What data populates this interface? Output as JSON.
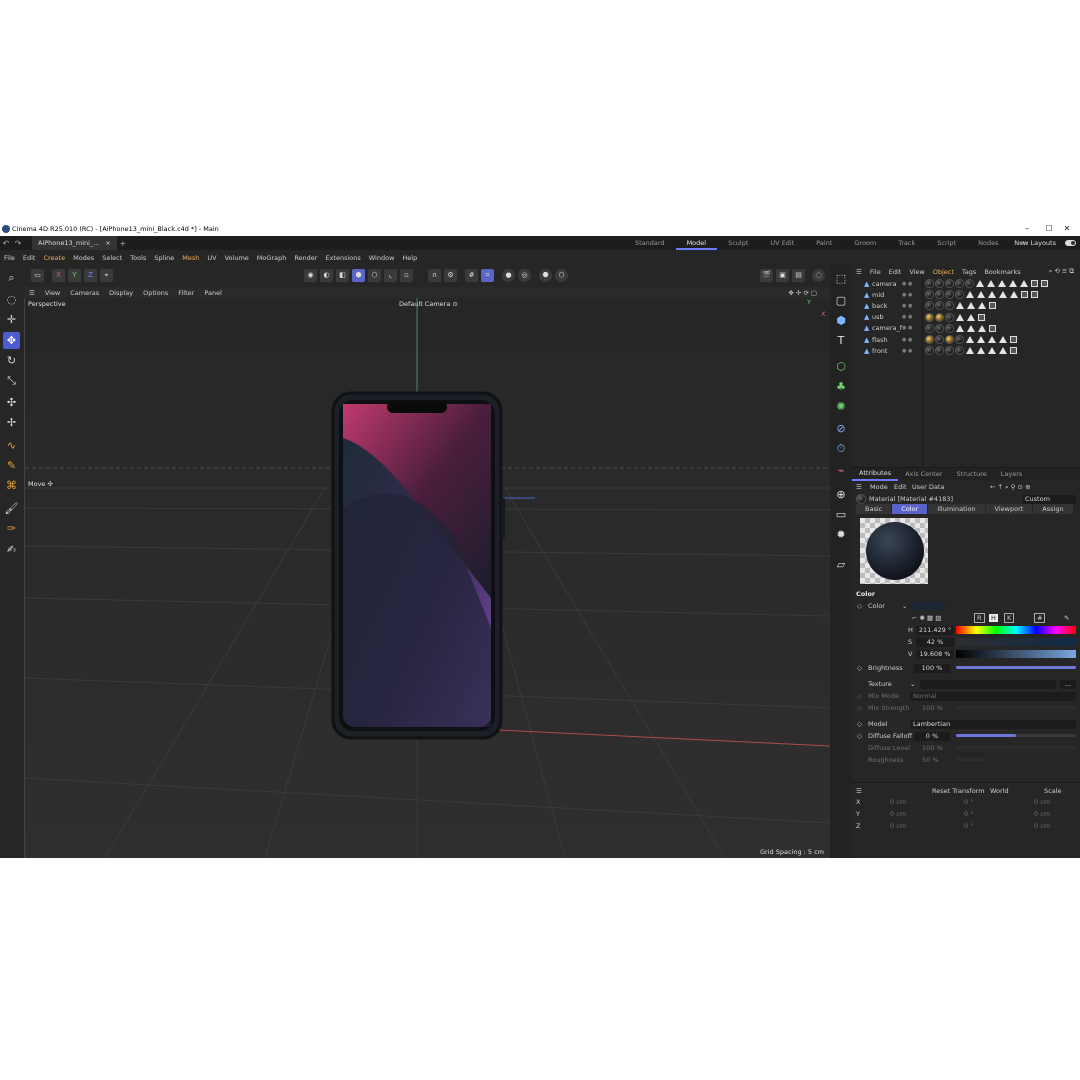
{
  "window": {
    "title": "Cinema 4D R25.010 (RC) - [AiPhone13_mini_Black.c4d *] - Main",
    "minimize": "–",
    "maximize": "☐",
    "close": "✕"
  },
  "tabbar": {
    "doc_tab": "AiPhone13_mini_...",
    "close": "×",
    "add": "+",
    "new_layouts": "New Layouts",
    "layouts": [
      "Standard",
      "Model",
      "Sculpt",
      "UV Edit",
      "Paint",
      "Groom",
      "Track",
      "Script",
      "Nodes"
    ],
    "layout_add": "+"
  },
  "menu": [
    "File",
    "Edit",
    "Create",
    "Modes",
    "Select",
    "Tools",
    "Spline",
    "Mesh",
    "UV",
    "Volume",
    "MoGraph",
    "Render",
    "Extensions",
    "Window",
    "Help"
  ],
  "toolbar": {
    "x": "X",
    "y": "Y",
    "z": "Z"
  },
  "viewport": {
    "menu": [
      "View",
      "Cameras",
      "Display",
      "Options",
      "Filter",
      "Panel"
    ],
    "perspective": "Perspective",
    "camera": "Default Camera ⊙",
    "move_label": "Move ✣",
    "grid_spacing": "Grid Spacing : 5 cm",
    "axis_y": "Y",
    "axis_x": "X"
  },
  "object_manager": {
    "menu": [
      "File",
      "Edit",
      "View",
      "Object",
      "Tags",
      "Bookmarks"
    ],
    "objects": [
      {
        "name": "camera"
      },
      {
        "name": "mid"
      },
      {
        "name": "back"
      },
      {
        "name": "usb"
      },
      {
        "name": "camera_f"
      },
      {
        "name": "flash"
      },
      {
        "name": "front"
      }
    ]
  },
  "attributes": {
    "tabs": [
      "Attributes",
      "Axis Center",
      "Structure",
      "Layers"
    ],
    "menu": [
      "Mode",
      "Edit",
      "User Data"
    ],
    "material_label": "Material [Material #4183]",
    "mode_value": "Custom",
    "subtabs": [
      "Basic",
      "Color",
      "Illumination",
      "Viewport",
      "Assign"
    ],
    "section": "Color",
    "color_label": "Color",
    "mode_buttons": [
      "R",
      "H",
      "K",
      "#"
    ],
    "h_label": "H",
    "h_value": "211.429 °",
    "s_label": "S",
    "s_value": "42 %",
    "v_label": "V",
    "v_value": "19.608 %",
    "brightness_label": "Brightness",
    "brightness_value": "100 %",
    "texture_label": "Texture",
    "texture_btn": "...",
    "mix_mode_label": "Mix Mode",
    "mix_mode_value": "Normal",
    "mix_strength_label": "Mix Strength",
    "mix_strength_value": "100 %",
    "model_label": "Model",
    "model_value": "Lambertian",
    "diffuse_falloff_label": "Diffuse Falloff",
    "diffuse_falloff_value": "0 %",
    "diffuse_level_label": "Diffuse Level",
    "diffuse_level_value": "100 %",
    "roughness_label": "Roughness",
    "roughness_value": "50 %",
    "brightness_fraction": 1.0,
    "diffuse_falloff_fraction": 0.5,
    "color_swatch": "#1d2533"
  },
  "coordinates": {
    "reset_transform": "Reset Transform",
    "world": "World",
    "scale": "Scale",
    "rows": [
      {
        "axis": "X",
        "pos": "0 cm",
        "rot": "0 °",
        "scale": "0 cm"
      },
      {
        "axis": "Y",
        "pos": "0 cm",
        "rot": "0 °",
        "scale": "0 cm"
      },
      {
        "axis": "Z",
        "pos": "0 cm",
        "rot": "0 °",
        "scale": "0 cm"
      }
    ]
  },
  "colors": {
    "accent": "#5a63c8",
    "highlight": "#f2b35a",
    "panel": "#262626"
  }
}
